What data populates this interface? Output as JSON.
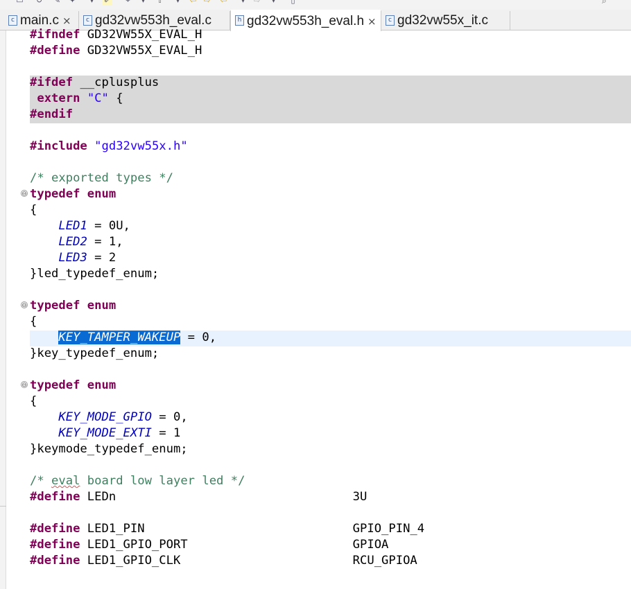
{
  "tabs": [
    {
      "label": "main.c",
      "icon": "c-file-icon",
      "closable": true,
      "active": false
    },
    {
      "label": "gd32vw553h_eval.c",
      "icon": "c-file-icon",
      "closable": false,
      "active": false
    },
    {
      "label": "gd32vw553h_eval.h",
      "icon": "h-file-icon",
      "closable": true,
      "active": true
    },
    {
      "label": "gd32vw55x_it.c",
      "icon": "c-file-icon",
      "closable": false,
      "active": false
    }
  ],
  "icon_glyphs": {
    "c": "c",
    "h": "h",
    "close": "×",
    "fold": "⊖"
  },
  "colors": {
    "keyword": "#7f0055",
    "string": "#2a00ff",
    "comment": "#3f7f5f",
    "enum_constant": "#0000c0",
    "inactive_bg": "#d9d9d9",
    "current_line_bg": "#e8f2fe",
    "selection": "#0a6ad4"
  },
  "code": {
    "l1": {
      "kw": "#ifndef",
      "rest": " GD32VW55X_EVAL_H"
    },
    "l2": {
      "kw": "#define",
      "rest": " GD32VW55X_EVAL_H"
    },
    "l4": {
      "kw": "#ifdef",
      "rest": " __cplusplus"
    },
    "l5": {
      "kw": "extern",
      "str": "\"C\"",
      "rest": " {"
    },
    "l6": {
      "kw": "#endif"
    },
    "l8": {
      "kw": "#include",
      "str": "\"gd32vw55x.h\""
    },
    "l10": {
      "cmt": "/* exported types */"
    },
    "l11": {
      "kw1": "typedef",
      "kw2": "enum"
    },
    "l12": {
      "text": "{"
    },
    "l13": {
      "enm": "LED1",
      "rest": " = 0U,"
    },
    "l14": {
      "enm": "LED2",
      "rest": " = 1,"
    },
    "l15": {
      "enm": "LED3",
      "rest": " = 2"
    },
    "l16": {
      "text": "}led_typedef_enum;"
    },
    "l18": {
      "kw1": "typedef",
      "kw2": "enum"
    },
    "l19": {
      "text": "{"
    },
    "l20": {
      "enm": "KEY_TAMPER_WAKEUP",
      "rest": " = 0,"
    },
    "l21": {
      "text": "}key_typedef_enum;"
    },
    "l23": {
      "kw1": "typedef",
      "kw2": "enum"
    },
    "l24": {
      "text": "{"
    },
    "l25": {
      "enm": "KEY_MODE_GPIO",
      "rest": " = 0,"
    },
    "l26": {
      "enm": "KEY_MODE_EXTI",
      "rest": " = 1"
    },
    "l27": {
      "text": "}keymode_typedef_enum;"
    },
    "l29": {
      "cmt_a": "/* ",
      "cmt_b": "eval",
      "cmt_c": " board low layer led */"
    },
    "l30": {
      "kw": "#define",
      "rest": " LEDn                                 3U"
    },
    "l32": {
      "kw": "#define",
      "rest": " LED1_PIN                             GPIO_PIN_4"
    },
    "l33": {
      "kw": "#define",
      "rest": " LED1_GPIO_PORT                       GPIOA"
    },
    "l34": {
      "kw": "#define",
      "rest": " LED1_GPIO_CLK                        RCU_GPIOA"
    }
  }
}
